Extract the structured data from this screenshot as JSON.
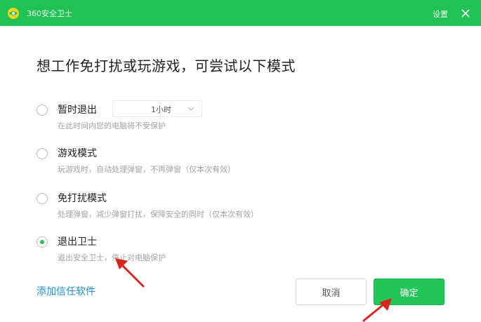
{
  "window": {
    "title": "360安全卫士",
    "settings_label": "设置"
  },
  "headline": "想工作免打扰或玩游戏，可尝试以下模式",
  "options": [
    {
      "label": "暂时退出",
      "desc": "在此时间内您的电脑将不受保护",
      "checked": false
    },
    {
      "label": "游戏模式",
      "desc": "玩游戏时，自动处理弹窗，不再弹窗（仅本次有效）",
      "checked": false
    },
    {
      "label": "免打扰模式",
      "desc": "处理弹窗，减少弹窗打扰，保障安全的同时（仅本次有效）",
      "checked": false
    },
    {
      "label": "退出卫士",
      "desc": "退出安全卫士，停止对电脑保护",
      "checked": true
    }
  ],
  "duration_select": {
    "value": "1小时"
  },
  "add_software_link": "添加信任软件",
  "buttons": {
    "cancel": "取消",
    "confirm": "确定"
  },
  "colors": {
    "accent": "#20c353",
    "link": "#1e8fd6",
    "annotation": "#d9261c"
  }
}
